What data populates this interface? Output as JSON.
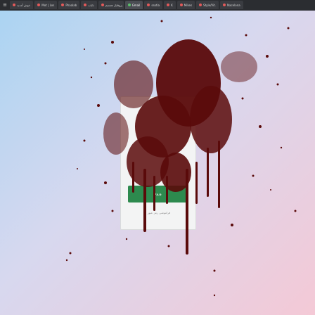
{
  "browser": {
    "tabs": [
      {
        "label": "خوش آمدید",
        "dot": "#e35a5a",
        "active": false
      },
      {
        "label": "Mot | Los",
        "dot": "#e35a5a",
        "active": false
      },
      {
        "label": "Phaalab",
        "dot": "#e35a5a",
        "active": false
      },
      {
        "label": "نایاب",
        "dot": "#e35a5a",
        "active": false
      },
      {
        "label": "پروفایل هستیم",
        "dot": "#e35a5a",
        "active": false
      },
      {
        "label": "Gmail",
        "dot": "#5bbf6a",
        "active": true
      },
      {
        "label": "ssotia",
        "dot": "#e35a5a",
        "active": false
      },
      {
        "label": "K",
        "dot": "#e35a5a",
        "active": false
      },
      {
        "label": "Mikes",
        "dot": "#e35a5a",
        "active": false
      },
      {
        "label": "Style/Vit.",
        "dot": "#e35a5a",
        "active": false
      },
      {
        "label": "Nacelona",
        "dot": "#e35a5a",
        "active": false
      }
    ],
    "menu_icon": "hamburger-menu-icon"
  },
  "card": {
    "button_label": "ورود",
    "note": "فراموشی رمز عبور"
  },
  "colors": {
    "splatter": "#5a0a0a",
    "button": "#2d8a4e"
  }
}
